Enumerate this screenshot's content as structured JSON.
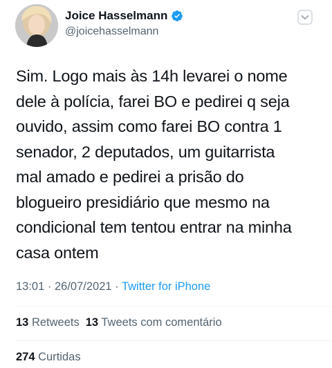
{
  "author": {
    "display_name": "Joice Hasselmann",
    "handle": "@joicehasselmann",
    "verified": true
  },
  "icons": {
    "verified": "verified-badge-icon",
    "more": "chevron-down-icon",
    "accent_color": "#1d9bf0"
  },
  "tweet": {
    "lines": [
      "Sim. Logo mais às 14h levarei o nome",
      "dele à polícia, farei BO e pedirei q seja",
      "ouvido, assim como farei BO contra 1",
      "senador, 2 deputados, um guitarrista",
      "mal amado e pedirei a prisão do",
      "blogueiro presidiário que mesmo na",
      "condicional tem tentou entrar na minha",
      "casa ontem"
    ]
  },
  "meta": {
    "time": "13:01",
    "sep1": " · ",
    "date": "26/07/2021",
    "sep2": " · ",
    "source": "Twitter for iPhone"
  },
  "stats": {
    "retweets_count": "13",
    "retweets_label": "Retweets",
    "quotes_count": "13",
    "quotes_label": "Tweets com comentário",
    "likes_count": "274",
    "likes_label": "Curtidas"
  }
}
